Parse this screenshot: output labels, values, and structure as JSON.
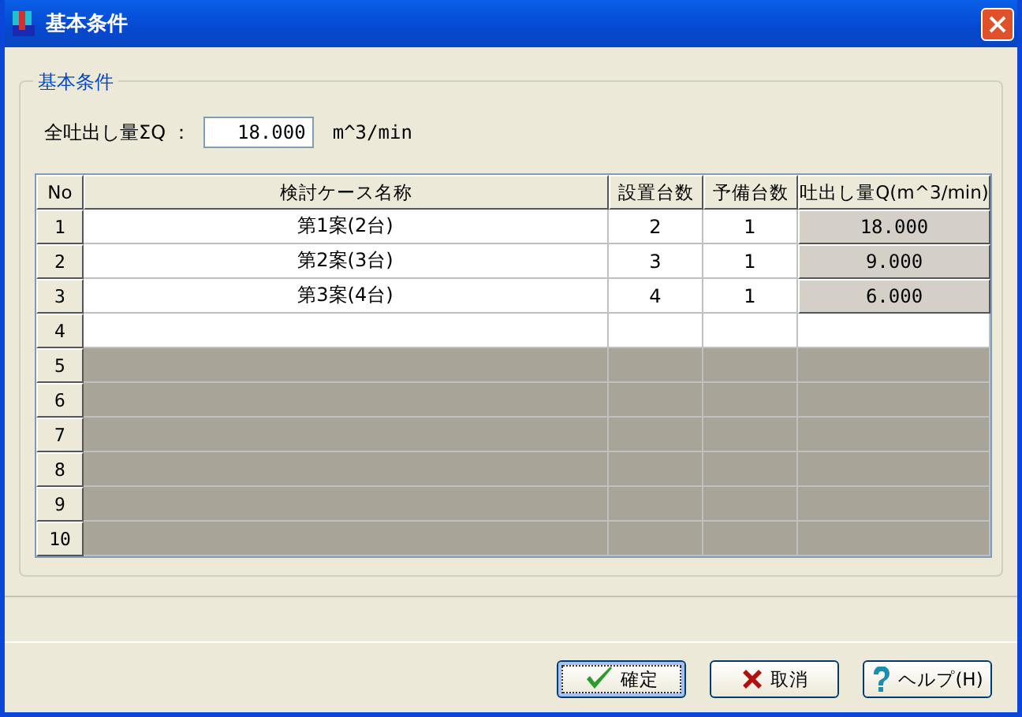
{
  "window": {
    "title": "基本条件"
  },
  "group": {
    "title": "基本条件"
  },
  "total": {
    "label": "全吐出し量ΣQ ：",
    "value": "18.000",
    "unit": "m^3/min"
  },
  "table": {
    "columns": [
      "No",
      "検討ケース名称",
      "設置台数",
      "予備台数",
      "吐出し量Q(m^3/min)"
    ],
    "rows": [
      {
        "kind": "filled",
        "no": "1",
        "name": "第1案(2台)",
        "installed": "2",
        "spare": "1",
        "flow": "18.000"
      },
      {
        "kind": "filled",
        "no": "2",
        "name": "第2案(3台)",
        "installed": "3",
        "spare": "1",
        "flow": "9.000"
      },
      {
        "kind": "filled",
        "no": "3",
        "name": "第3案(4台)",
        "installed": "4",
        "spare": "1",
        "flow": "6.000"
      },
      {
        "kind": "empty",
        "no": "4"
      },
      {
        "kind": "disabled",
        "no": "5"
      },
      {
        "kind": "disabled",
        "no": "6"
      },
      {
        "kind": "disabled",
        "no": "7"
      },
      {
        "kind": "disabled",
        "no": "8"
      },
      {
        "kind": "disabled",
        "no": "9"
      },
      {
        "kind": "disabled",
        "no": "10"
      }
    ]
  },
  "buttons": [
    {
      "kind": "ok",
      "label": "確定",
      "focused": true
    },
    {
      "kind": "cancel",
      "label": "取消",
      "focused": false
    },
    {
      "kind": "help",
      "label": "ヘルプ(H)",
      "focused": false
    }
  ]
}
